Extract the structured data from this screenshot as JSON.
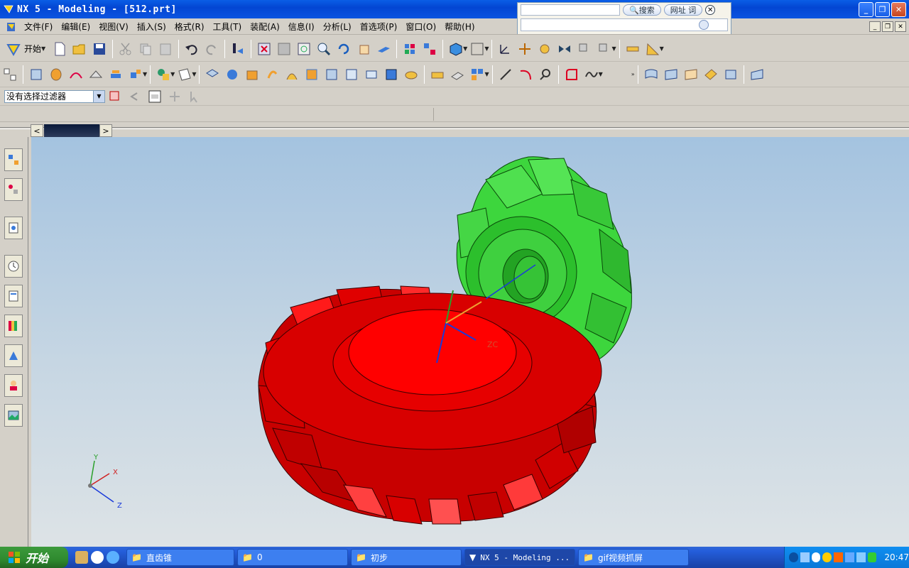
{
  "window": {
    "title": "NX 5 - Modeling - [512.prt]"
  },
  "search_popup": {
    "search_label": "搜索",
    "url_label": "网址 词"
  },
  "menu": {
    "items": [
      "文件(F)",
      "编辑(E)",
      "视图(V)",
      "插入(S)",
      "格式(R)",
      "工具(T)",
      "装配(A)",
      "信息(I)",
      "分析(L)",
      "首选项(P)",
      "窗口(O)",
      "帮助(H)"
    ]
  },
  "toolbar": {
    "start_label": "开始"
  },
  "selection_filter": {
    "value": "没有选择过滤器"
  },
  "viewport": {
    "triad": {
      "x": "X",
      "y": "Y",
      "z": "Z"
    },
    "wcs_label": "ZC",
    "colors": {
      "red_gear": "#e80000",
      "green_gear": "#2ecc2e"
    }
  },
  "taskbar": {
    "start": "开始",
    "tasks": [
      "直齿锥",
      "0",
      "初步",
      "NX 5 - Modeling ...",
      "gif视频抓屏"
    ],
    "clock": "20:47"
  }
}
